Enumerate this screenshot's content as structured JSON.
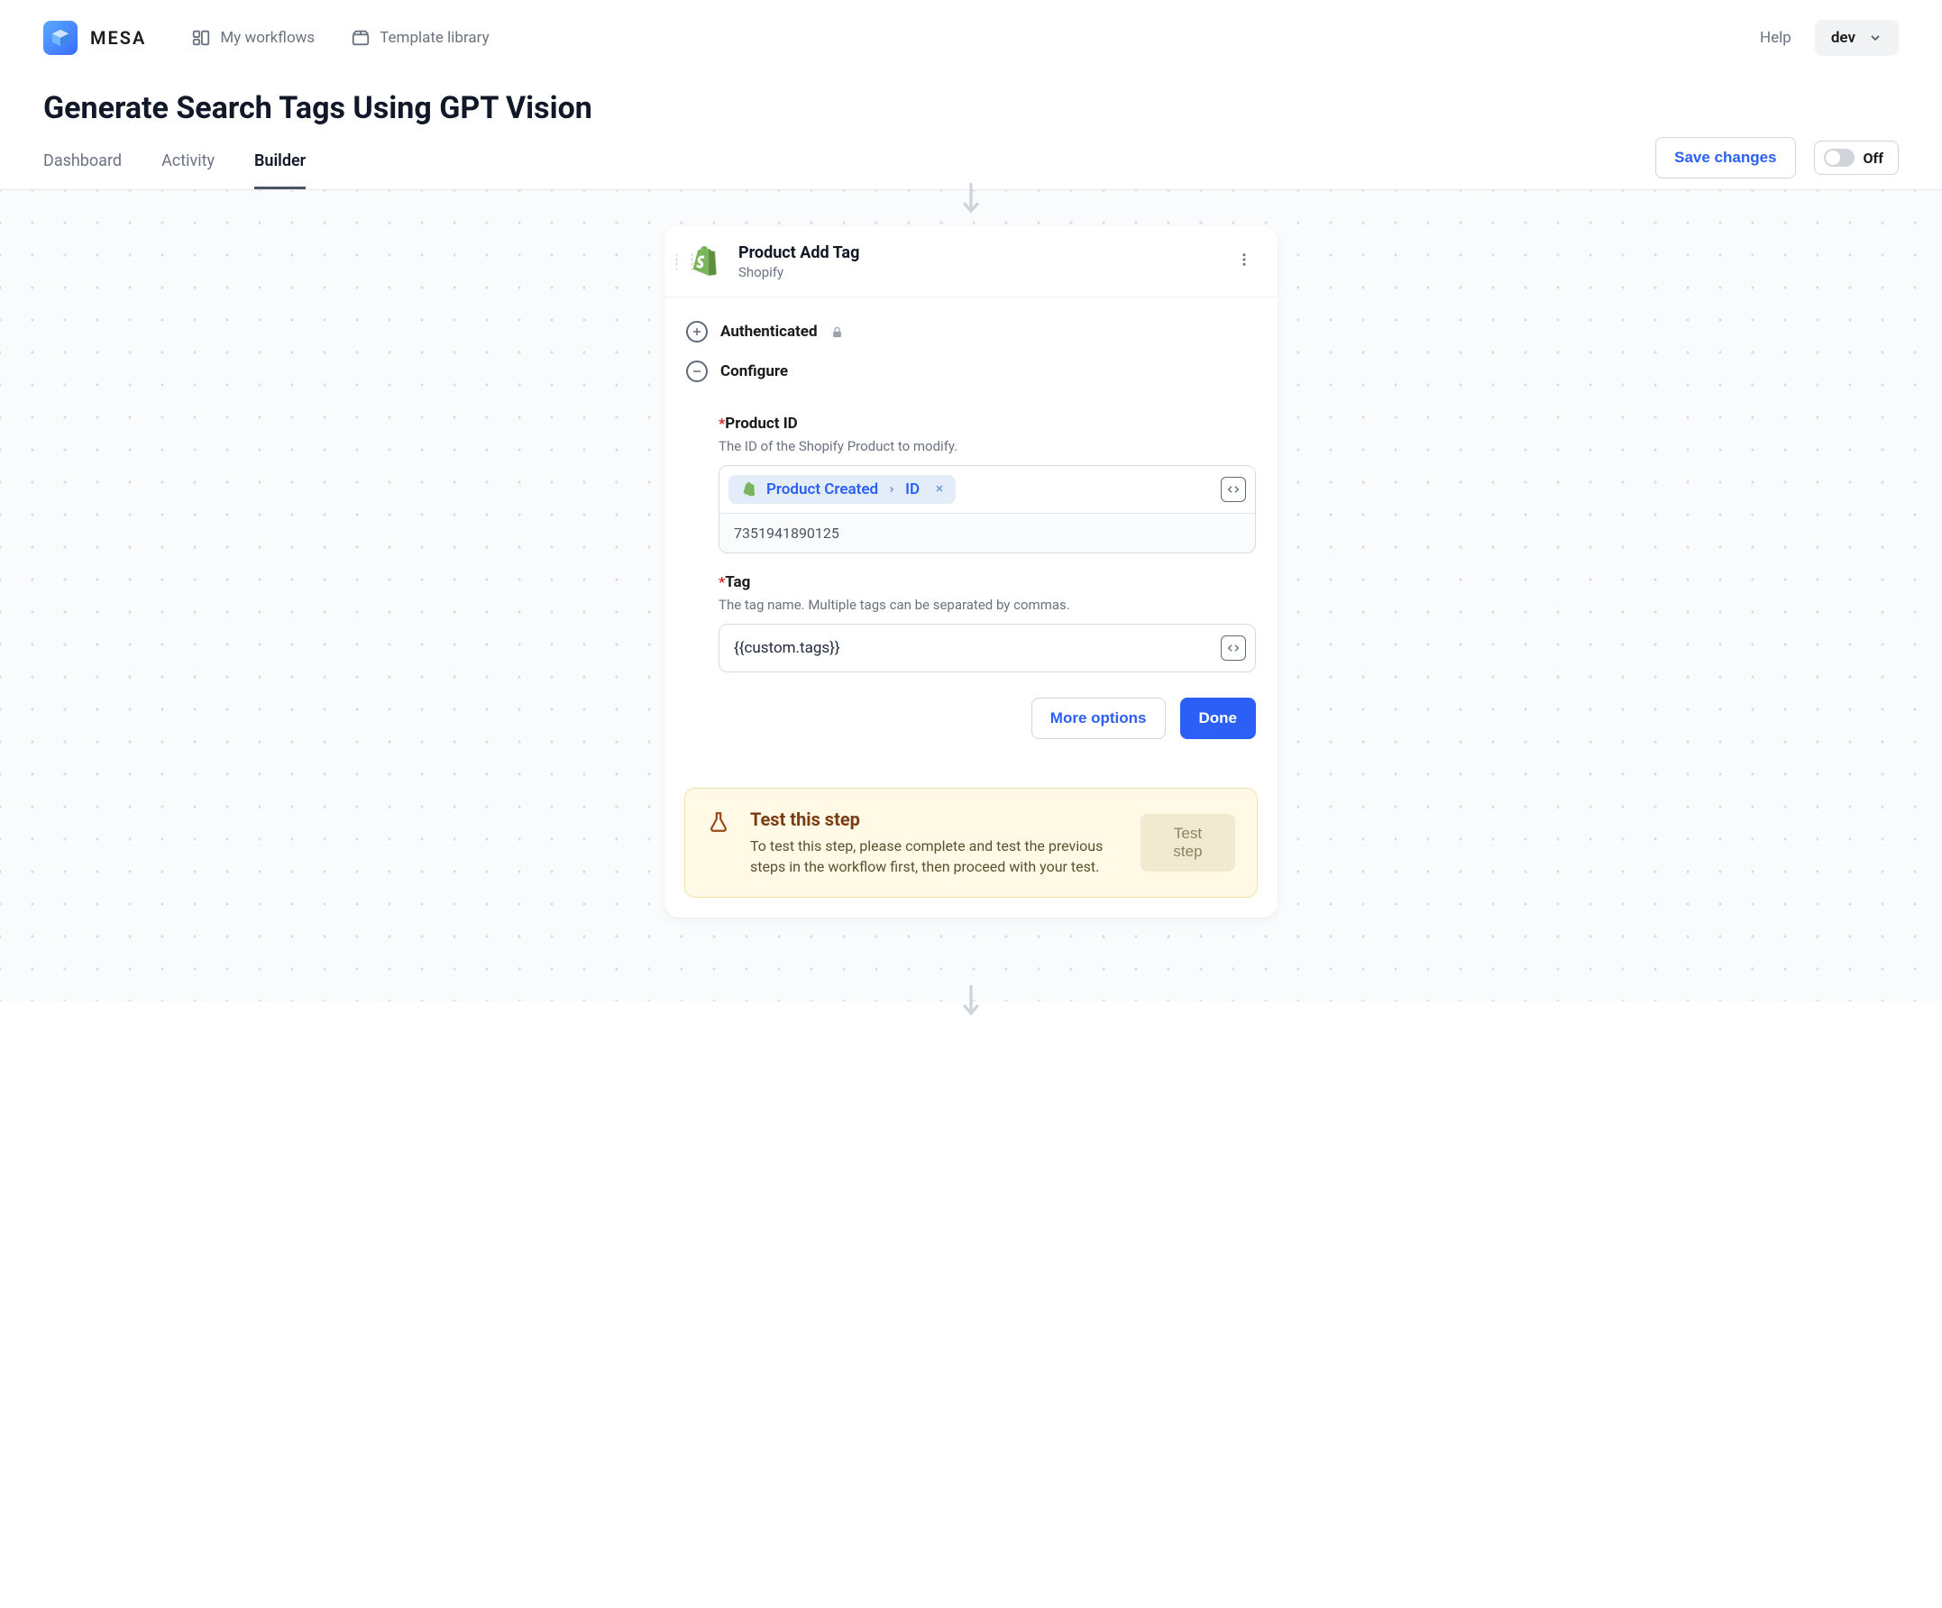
{
  "brand": {
    "name": "MESA"
  },
  "nav": {
    "workflows": "My workflows",
    "templates": "Template library",
    "help": "Help",
    "env": "dev"
  },
  "page": {
    "title": "Generate Search Tags Using GPT Vision"
  },
  "tabs": {
    "dashboard": "Dashboard",
    "activity": "Activity",
    "builder": "Builder"
  },
  "actions": {
    "save": "Save changes",
    "toggle_label": "Off"
  },
  "step": {
    "title": "Product Add Tag",
    "provider": "Shopify",
    "sections": {
      "authenticated": "Authenticated",
      "configure": "Configure"
    },
    "fields": {
      "product_id": {
        "label": "Product ID",
        "desc": "The ID of the Shopify Product to modify.",
        "token_source": "Product Created",
        "token_field": "ID",
        "resolved": "7351941890125"
      },
      "tag": {
        "label": "Tag",
        "desc": "The tag name. Multiple tags can be separated by commas.",
        "value": "{{custom.tags}}"
      }
    },
    "buttons": {
      "more": "More options",
      "done": "Done"
    },
    "test": {
      "title": "Test this step",
      "body": "To test this step, please complete and test the previous steps in the workflow first, then proceed with your test.",
      "button": "Test step"
    }
  }
}
